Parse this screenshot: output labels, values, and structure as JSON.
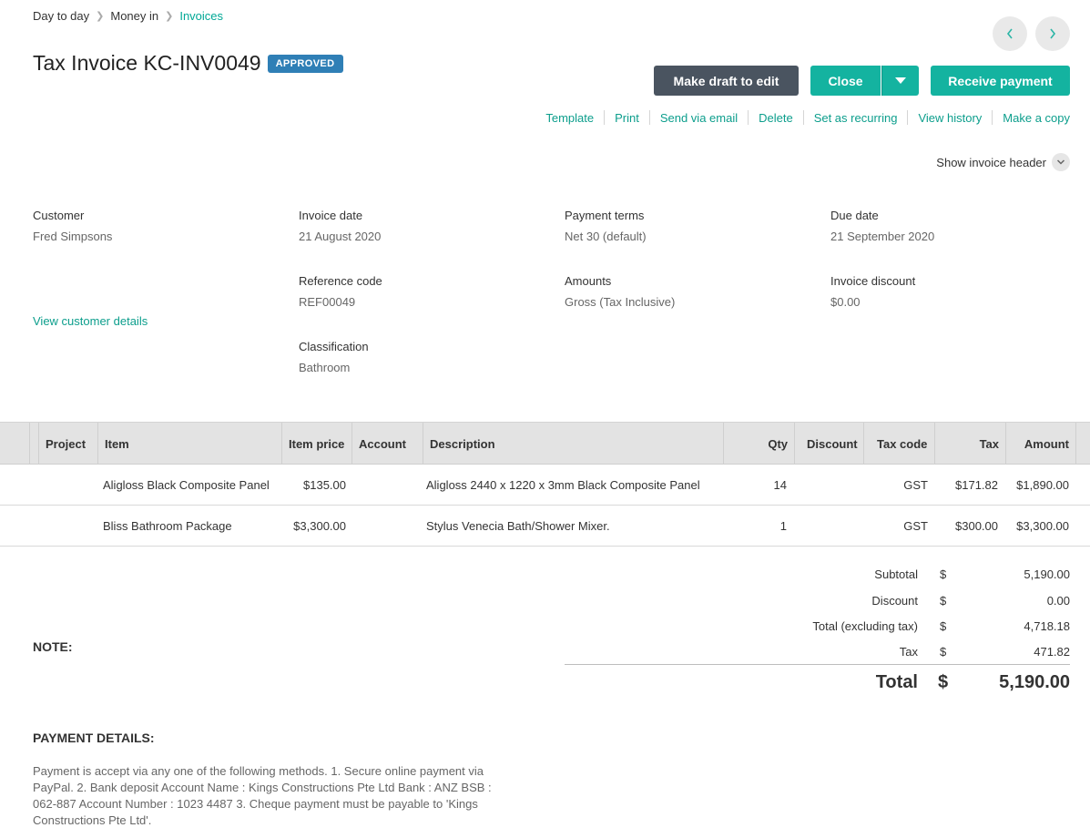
{
  "breadcrumb": {
    "items": [
      "Day to day",
      "Money in",
      "Invoices"
    ]
  },
  "pager": {
    "prev_icon": "chevron-left-icon",
    "next_icon": "chevron-right-icon"
  },
  "invoice": {
    "title": "Tax Invoice KC-INV0049",
    "status": "APPROVED"
  },
  "buttons": {
    "make_draft": "Make draft to edit",
    "close": "Close",
    "receive_payment": "Receive payment"
  },
  "actions": [
    "Template",
    "Print",
    "Send via email",
    "Delete",
    "Set as recurring",
    "View history",
    "Make a copy"
  ],
  "show_header_label": "Show invoice header",
  "fields": {
    "customer": {
      "label": "Customer",
      "value": "Fred Simpsons"
    },
    "invoice_date": {
      "label": "Invoice date",
      "value": "21 August 2020"
    },
    "payment_terms": {
      "label": "Payment terms",
      "value": "Net 30 (default)"
    },
    "due_date": {
      "label": "Due date",
      "value": "21 September 2020"
    },
    "reference_code": {
      "label": "Reference code",
      "value": "REF00049"
    },
    "amounts": {
      "label": "Amounts",
      "value": "Gross (Tax Inclusive)"
    },
    "invoice_discount": {
      "label": "Invoice discount",
      "value": "$0.00"
    },
    "classification": {
      "label": "Classification",
      "value": "Bathroom"
    },
    "view_customer_link": "View customer details"
  },
  "table": {
    "headers": {
      "project": "Project",
      "item": "Item",
      "item_price": "Item price",
      "account": "Account",
      "description": "Description",
      "qty": "Qty",
      "discount": "Discount",
      "tax_code": "Tax code",
      "tax": "Tax",
      "amount": "Amount"
    },
    "rows": [
      {
        "project": "",
        "item": "Aligloss Black Composite Panel",
        "item_price": "$135.00",
        "account": "",
        "description": "Aligloss 2440 x 1220 x 3mm Black Composite Panel",
        "qty": "14",
        "discount": "",
        "tax_code": "GST",
        "tax": "$171.82",
        "amount": "$1,890.00"
      },
      {
        "project": "",
        "item": "Bliss Bathroom Package",
        "item_price": "$3,300.00",
        "account": "",
        "description": "Stylus Venecia Bath/Shower Mixer.",
        "qty": "1",
        "discount": "",
        "tax_code": "GST",
        "tax": "$300.00",
        "amount": "$3,300.00"
      }
    ]
  },
  "totals": {
    "currency": "$",
    "subtotal": {
      "label": "Subtotal",
      "value": "5,190.00"
    },
    "discount": {
      "label": "Discount",
      "value": "0.00"
    },
    "total_ex_tax": {
      "label": "Total (excluding tax)",
      "value": "4,718.18"
    },
    "tax": {
      "label": "Tax",
      "value": "471.82"
    },
    "total": {
      "label": "Total",
      "value": "5,190.00"
    }
  },
  "note": {
    "label": "NOTE:"
  },
  "payment_details": {
    "label": "PAYMENT DETAILS:",
    "text": "Payment is accept via any one of the following methods. 1. Secure online payment via PayPal. 2. Bank deposit Account Name : Kings Constructions Pte Ltd Bank : ANZ BSB : 062-887 Account Number : 1023 4487 3. Cheque payment must be payable to 'Kings Constructions Pte Ltd'."
  }
}
